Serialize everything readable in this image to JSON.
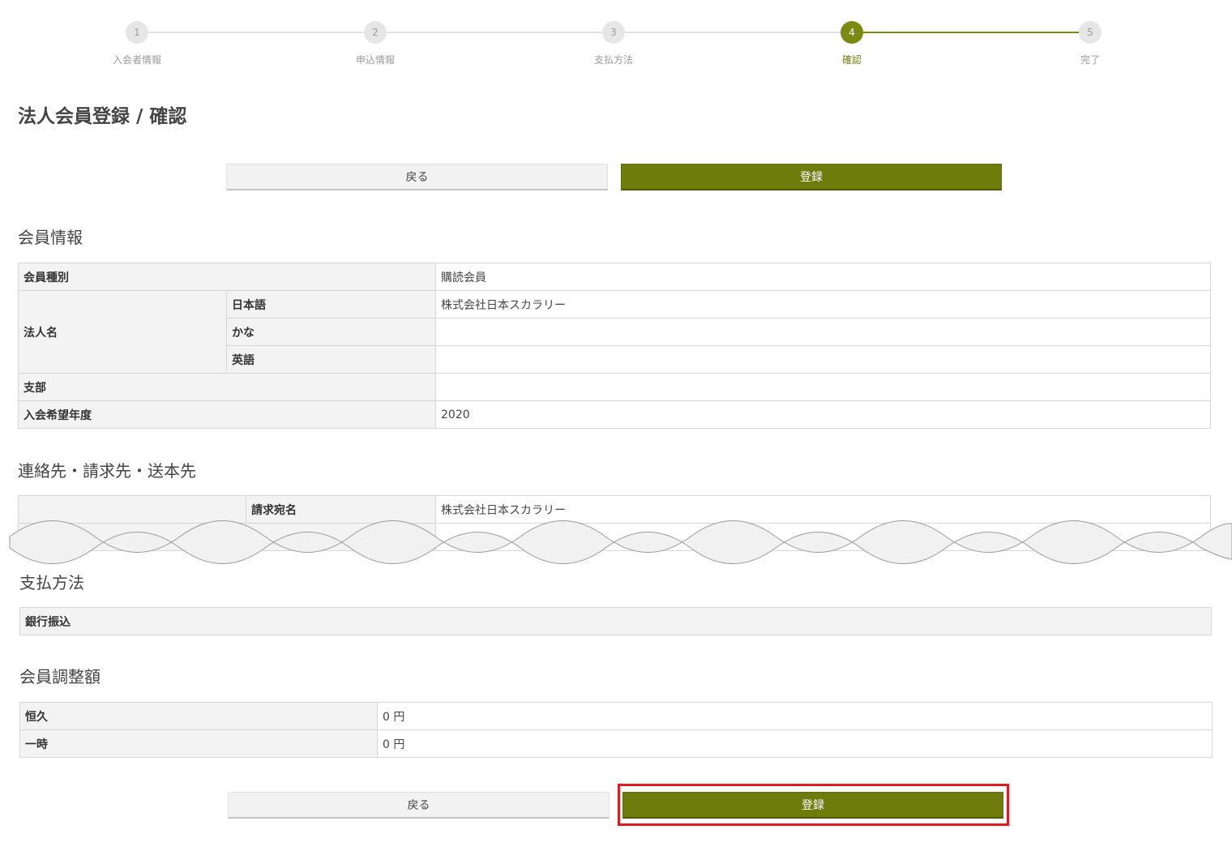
{
  "stepper": {
    "steps": [
      {
        "number": "1",
        "label": "入会者情報"
      },
      {
        "number": "2",
        "label": "申込情報"
      },
      {
        "number": "3",
        "label": "支払方法"
      },
      {
        "number": "4",
        "label": "確認"
      },
      {
        "number": "5",
        "label": "完了"
      }
    ],
    "current": 4,
    "accent_color": "#7a8a10"
  },
  "page": {
    "title": "法人会員登録 / 確認"
  },
  "buttons": {
    "back_label": "戻る",
    "submit_label": "登録"
  },
  "member_info": {
    "title": "会員情報",
    "member_type_label": "会員種別",
    "member_type_value": "購読会員",
    "corp_name_label": "法人名",
    "corp_name_ja_label": "日本語",
    "corp_name_ja_value": "株式会社日本スカラリー",
    "corp_name_kana_label": "かな",
    "corp_name_kana_value": "",
    "corp_name_en_label": "英語",
    "corp_name_en_value": "",
    "branch_label": "支部",
    "branch_value": "",
    "join_year_label": "入会希望年度",
    "join_year_value": "2020"
  },
  "contact": {
    "title": "連絡先・請求先・送本先",
    "billing_name_label": "請求宛名",
    "billing_name_value": "株式会社日本スカラリー"
  },
  "payment": {
    "title": "支払方法",
    "method": "銀行振込"
  },
  "adjustment": {
    "title": "会員調整額",
    "permanent_label": "恒久",
    "permanent_value": "0 円",
    "temporary_label": "一時",
    "temporary_value": "0 円"
  }
}
